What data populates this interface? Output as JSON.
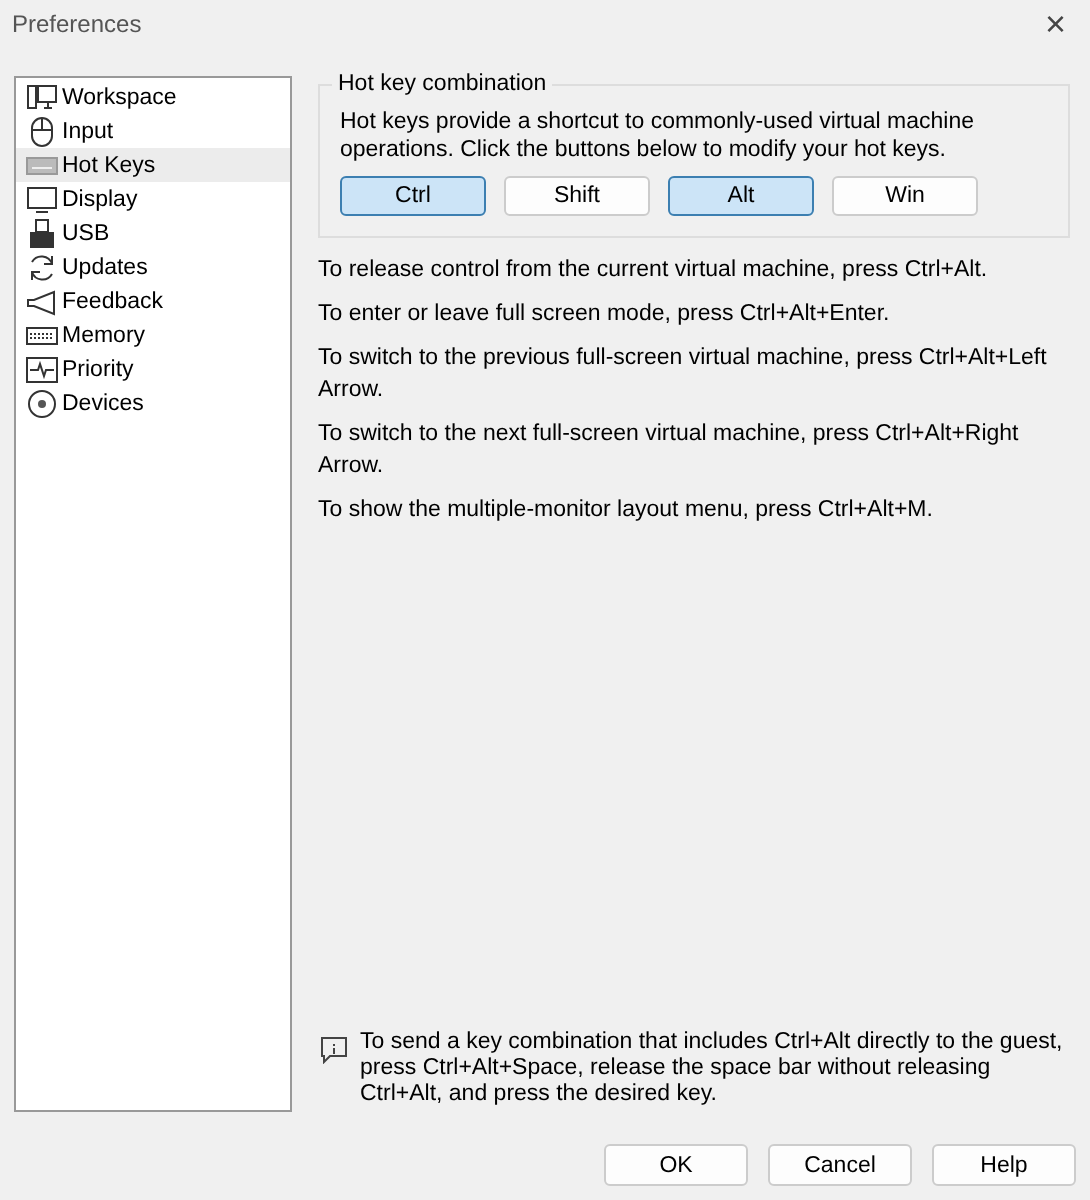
{
  "window": {
    "title": "Preferences",
    "close": "×"
  },
  "sidebar": {
    "items": [
      {
        "label": "Workspace",
        "kind": "workspace",
        "selected": false
      },
      {
        "label": "Input",
        "kind": "mouse",
        "selected": false
      },
      {
        "label": "Hot Keys",
        "kind": "keyboard",
        "selected": true
      },
      {
        "label": "Display",
        "kind": "monitor",
        "selected": false
      },
      {
        "label": "USB",
        "kind": "usb",
        "selected": false
      },
      {
        "label": "Updates",
        "kind": "refresh",
        "selected": false
      },
      {
        "label": "Feedback",
        "kind": "megaphone",
        "selected": false
      },
      {
        "label": "Memory",
        "kind": "memory",
        "selected": false
      },
      {
        "label": "Priority",
        "kind": "pulse",
        "selected": false
      },
      {
        "label": "Devices",
        "kind": "disc",
        "selected": false
      }
    ]
  },
  "hotkey_group": {
    "title": "Hot key combination",
    "description": "Hot keys provide a shortcut to commonly-used virtual machine operations. Click the buttons below to modify your hot keys.",
    "keys": [
      {
        "label": "Ctrl",
        "selected": true
      },
      {
        "label": "Shift",
        "selected": false
      },
      {
        "label": "Alt",
        "selected": true
      },
      {
        "label": "Win",
        "selected": false
      }
    ]
  },
  "instructions": [
    "To release control from the current virtual machine, press Ctrl+Alt.",
    "To enter or leave full screen mode, press Ctrl+Alt+Enter.",
    "To switch to the previous full-screen virtual machine, press Ctrl+Alt+Left Arrow.",
    "To switch to the next full-screen virtual machine, press Ctrl+Alt+Right Arrow.",
    "To show the multiple-monitor layout menu, press Ctrl+Alt+M."
  ],
  "note": "To send a key combination that includes Ctrl+Alt directly to the guest, press Ctrl+Alt+Space, release the space bar without releasing Ctrl+Alt, and press the desired key.",
  "buttons": [
    "OK",
    "Cancel",
    "Help"
  ]
}
